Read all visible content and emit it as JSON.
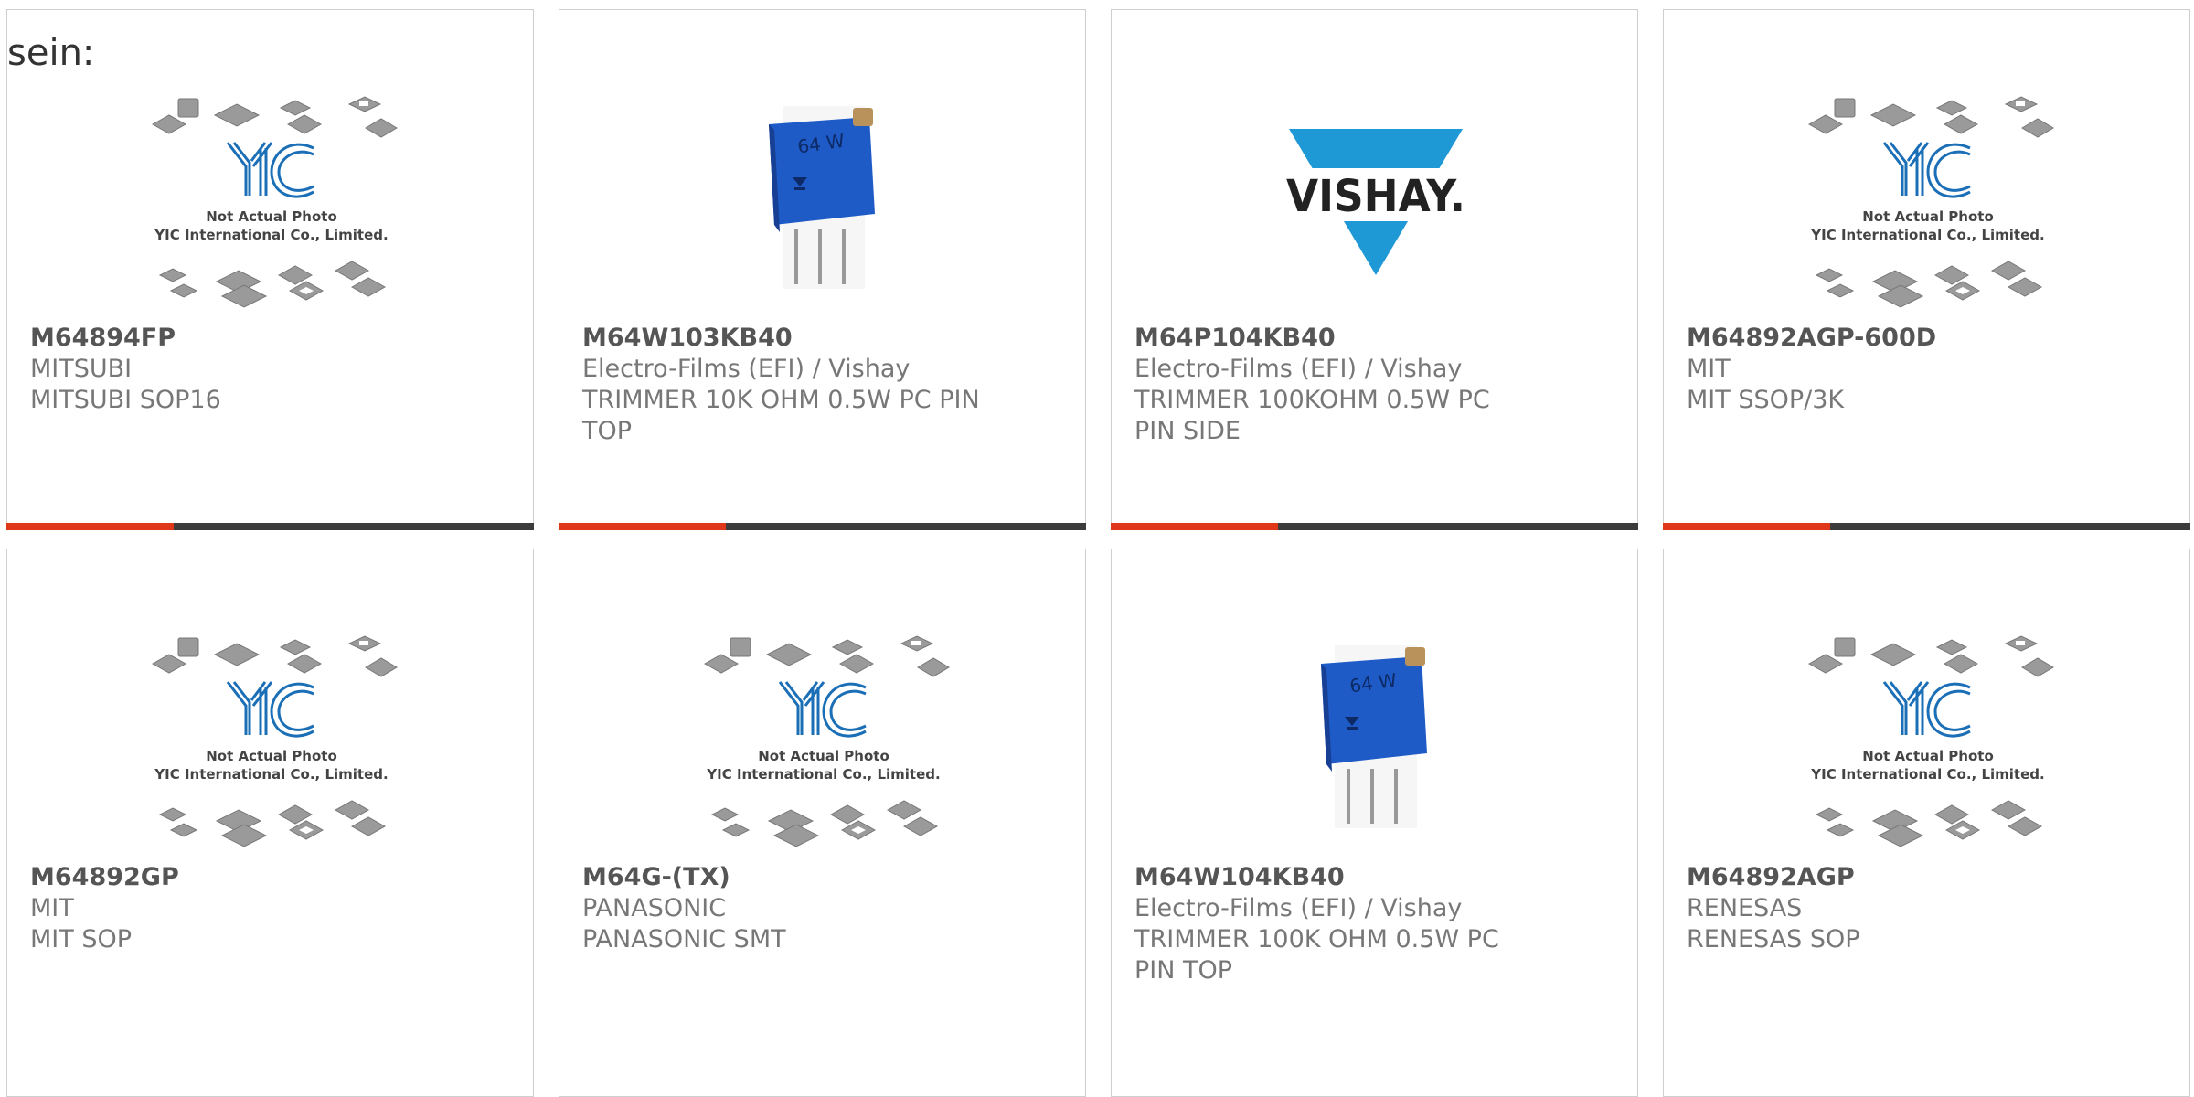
{
  "heading": "sein:",
  "placeholder_image": {
    "logo": "YIC",
    "line1": "Not Actual Photo",
    "line2": "YIC International Co., Limited."
  },
  "vishay_logo_text": "VISHAY.",
  "trimmer_marking": "64 W",
  "colors": {
    "accent": "#e0361a",
    "bar": "#3c3c3c",
    "yic_blue": "#1b6fb7",
    "trimmer_blue": "#1e5bc6",
    "vishay_blue": "#1f98d6"
  },
  "products": [
    {
      "part": "M64894FP",
      "manufacturer": "MITSUBI",
      "description": "MITSUBI SOP16",
      "image": "placeholder"
    },
    {
      "part": "M64W103KB40",
      "manufacturer": "Electro-Films (EFI) / Vishay",
      "description": "TRIMMER 10K OHM 0.5W PC PIN TOP",
      "image": "trimmer"
    },
    {
      "part": "M64P104KB40",
      "manufacturer": "Electro-Films (EFI) / Vishay",
      "description": "TRIMMER 100KOHM 0.5W PC PIN SIDE",
      "image": "vishay-logo"
    },
    {
      "part": "M64892AGP-600D",
      "manufacturer": "MIT",
      "description": "MIT SSOP/3K",
      "image": "placeholder"
    },
    {
      "part": "M64892GP",
      "manufacturer": "MIT",
      "description": "MIT SOP",
      "image": "placeholder"
    },
    {
      "part": "M64G-(TX)",
      "manufacturer": "PANASONIC",
      "description": "PANASONIC SMT",
      "image": "placeholder"
    },
    {
      "part": "M64W104KB40",
      "manufacturer": "Electro-Films (EFI) / Vishay",
      "description": "TRIMMER 100K OHM 0.5W PC PIN TOP",
      "image": "trimmer"
    },
    {
      "part": "M64892AGP",
      "manufacturer": "RENESAS",
      "description": "RENESAS SOP",
      "image": "placeholder"
    }
  ]
}
